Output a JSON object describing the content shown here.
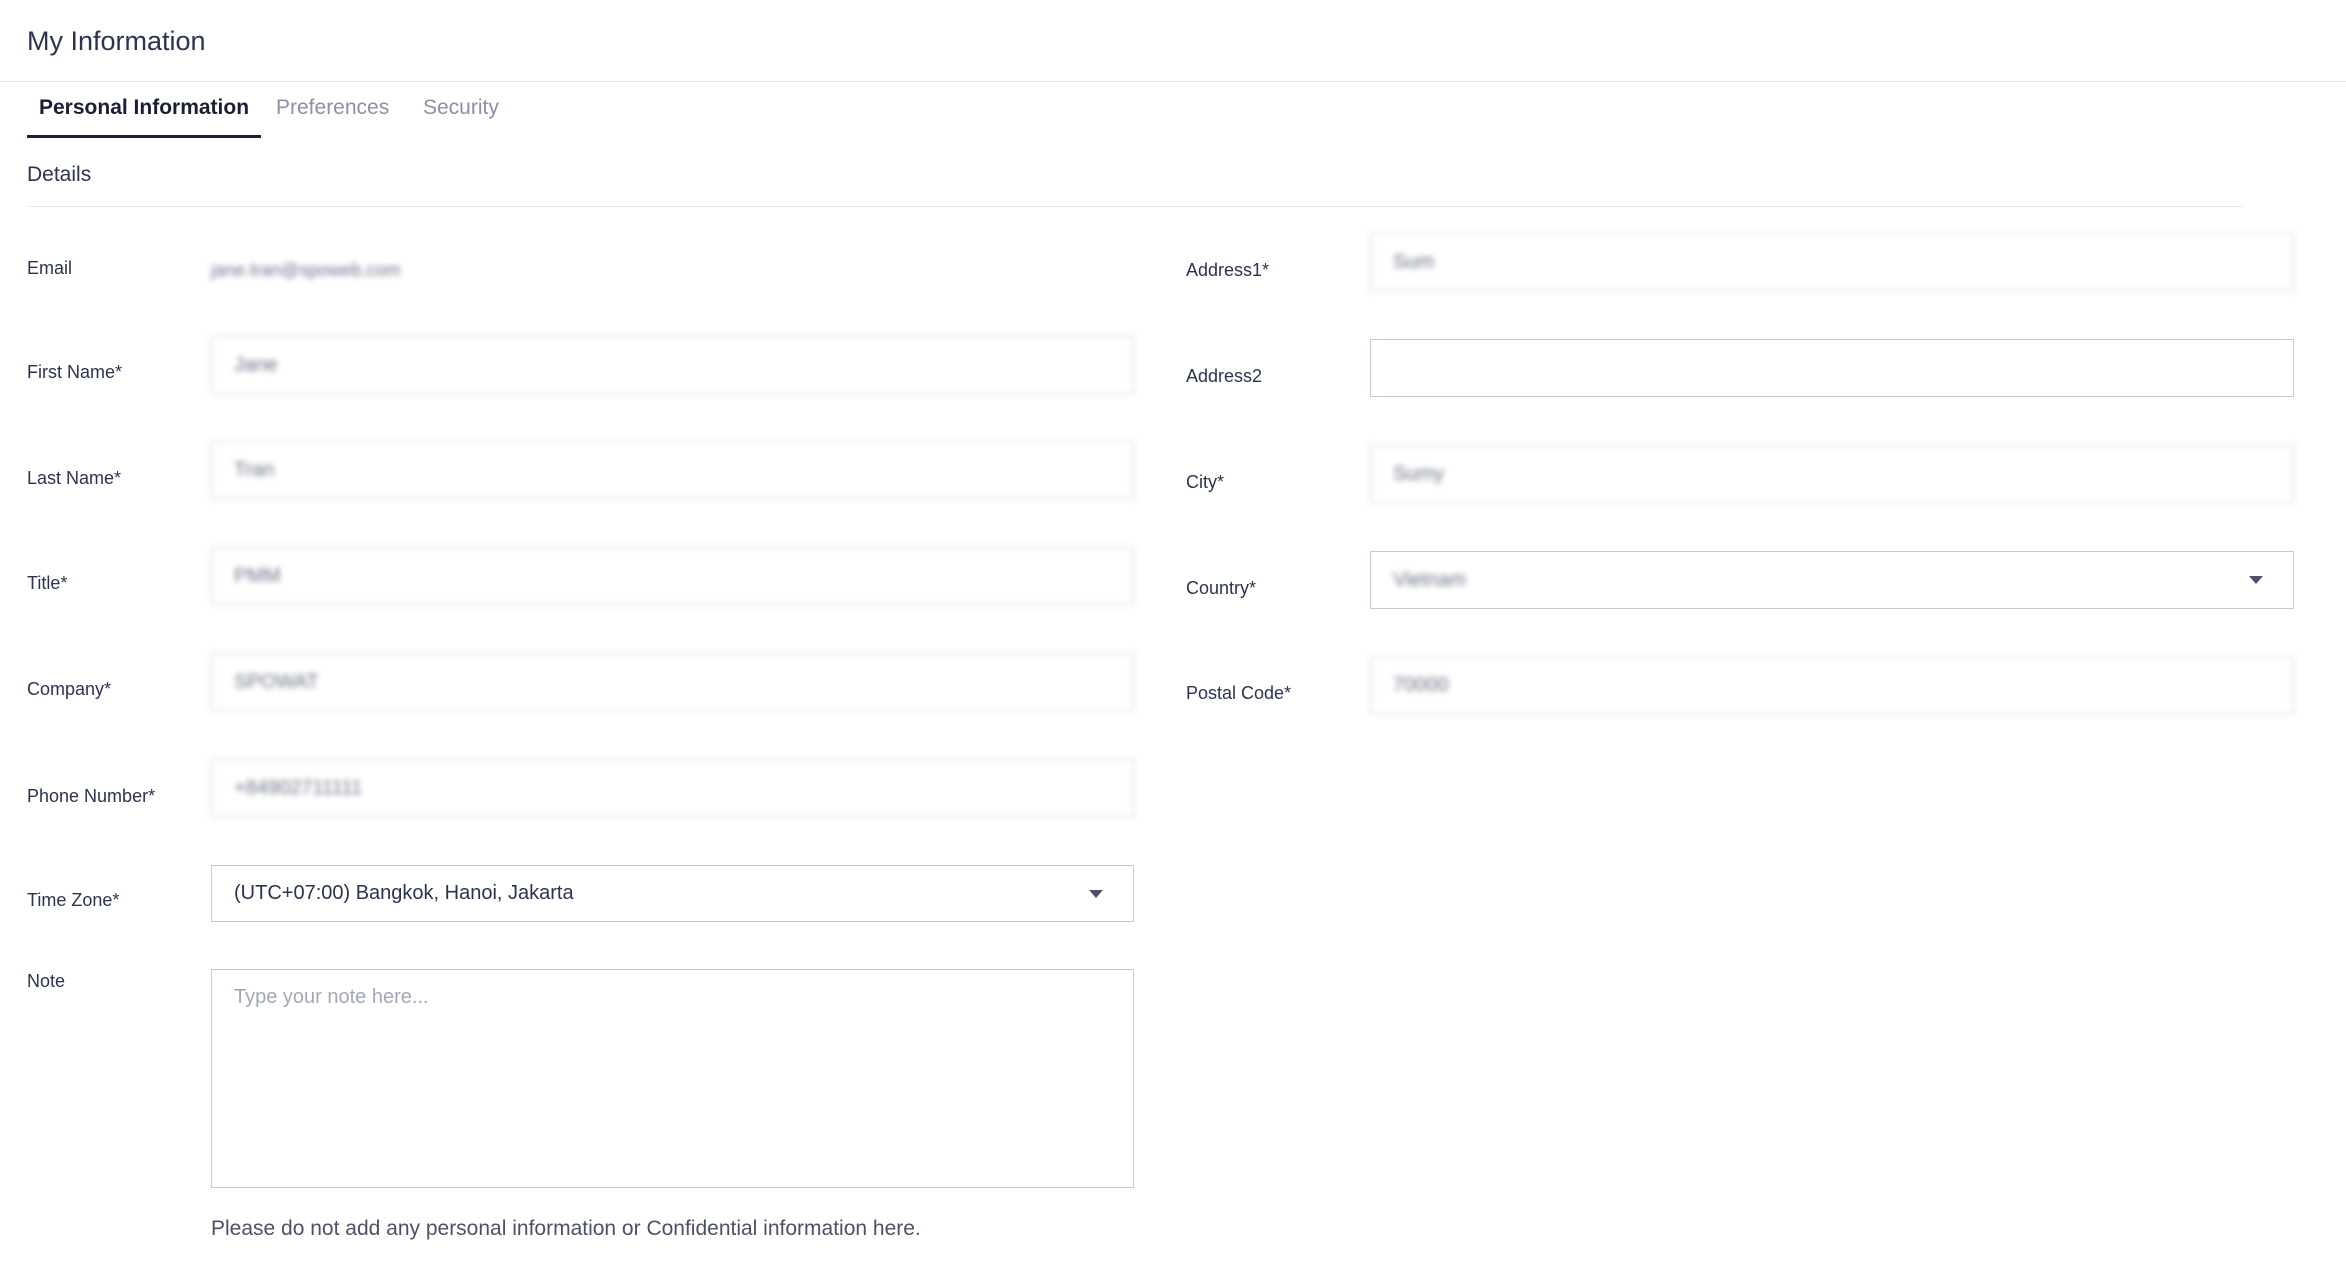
{
  "page": {
    "title": "My Information"
  },
  "tabs": [
    {
      "label": "Personal Information",
      "active": true
    },
    {
      "label": "Preferences",
      "active": false
    },
    {
      "label": "Security",
      "active": false
    }
  ],
  "section": {
    "title": "Details"
  },
  "left": {
    "email": {
      "label": "Email",
      "value": "jane.tran@spoweb.com"
    },
    "first_name": {
      "label": "First Name*",
      "value": "Jane"
    },
    "last_name": {
      "label": "Last Name*",
      "value": "Tran"
    },
    "title": {
      "label": "Title*",
      "value": "PMM"
    },
    "company": {
      "label": "Company*",
      "value": "SPOWAT"
    },
    "phone": {
      "label": "Phone Number*",
      "value": "+84902711111"
    },
    "time_zone": {
      "label": "Time Zone*",
      "value": "(UTC+07:00) Bangkok, Hanoi, Jakarta"
    },
    "note": {
      "label": "Note",
      "placeholder": "Type your note here..."
    },
    "hint": "Please do not add any personal information or Confidential information here."
  },
  "right": {
    "address1": {
      "label": "Address1*",
      "value": "Sum"
    },
    "address2": {
      "label": "Address2",
      "value": ""
    },
    "city": {
      "label": "City*",
      "value": "Sumy"
    },
    "country": {
      "label": "Country*",
      "value": "Vietnam"
    },
    "postal_code": {
      "label": "Postal Code*",
      "value": "70000"
    }
  },
  "colors": {
    "text": "#2b3352",
    "muted": "#8a90a6",
    "border": "#c7cad3",
    "active_tab": "#1a1f36"
  }
}
